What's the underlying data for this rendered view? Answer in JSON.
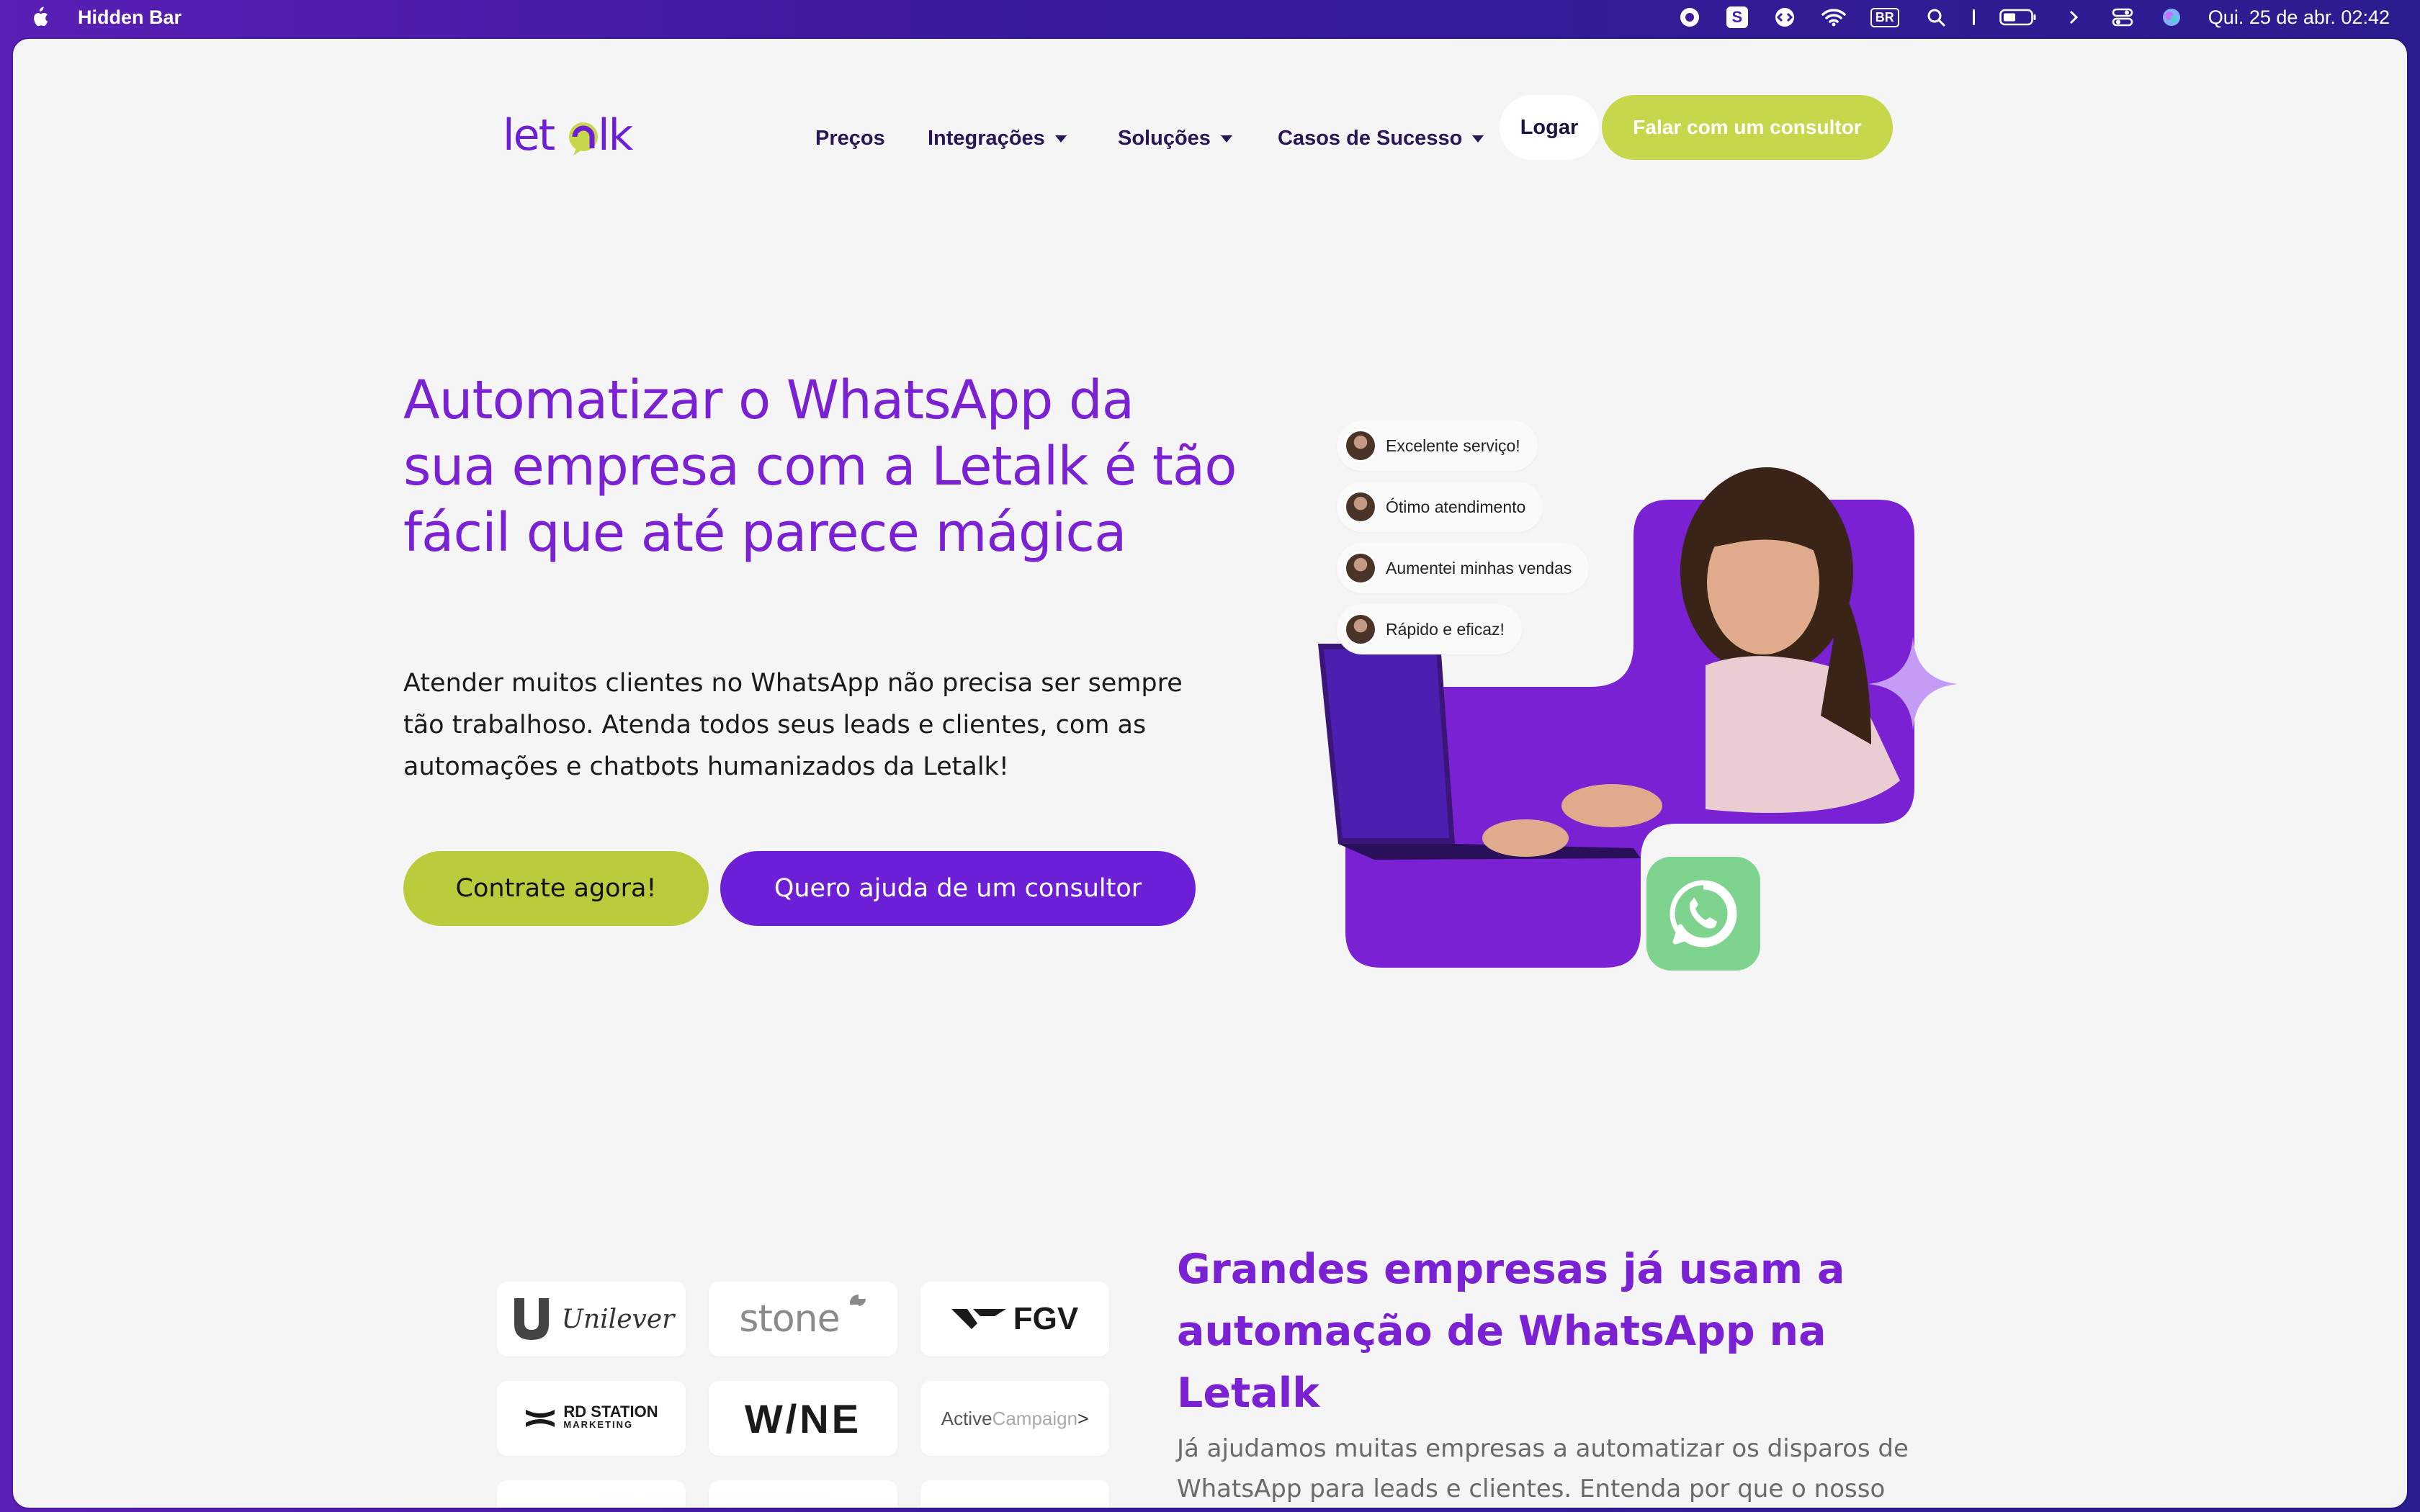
{
  "menubar": {
    "app_name": "Hidden Bar",
    "input_source": "BR",
    "skype_letter": "S",
    "clock": "Qui. 25 de abr.  02:42"
  },
  "nav": {
    "logo": "letalk",
    "items": [
      {
        "label": "Preços",
        "has_dropdown": false
      },
      {
        "label": "Integrações",
        "has_dropdown": true
      },
      {
        "label": "Soluções",
        "has_dropdown": true
      },
      {
        "label": "Casos de Sucesso",
        "has_dropdown": true
      }
    ],
    "login_label": "Logar",
    "consult_label": "Falar com um consultor"
  },
  "hero": {
    "title": "Automatizar o WhatsApp da sua empresa com a Letalk é tão fácil que até parece mágica",
    "subtitle": "Atender muitos clientes no WhatsApp não precisa ser sempre tão trabalhoso. Atenda todos seus leads e clientes, com as automações e chatbots humanizados da Letalk!",
    "cta_primary": "Contrate agora!",
    "cta_secondary": "Quero ajuda de um consultor",
    "testimonials": [
      "Excelente serviço!",
      "Ótimo atendimento",
      "Aumentei minhas vendas",
      "Rápido e eficaz!"
    ]
  },
  "clients": {
    "title": "Grandes empresas já usam a automação de WhatsApp na Letalk",
    "text": "Já ajudamos muitas empresas a automatizar os disparos de WhatsApp para leads e clientes. Entenda por que o nosso serviço também é ideal para o seu negócio. Conheça nossos",
    "logos": {
      "unilever": "Unilever",
      "stone": "stone",
      "fgv": "FGV",
      "rd_line1": "RD STATION",
      "rd_line2": "MARKETING",
      "wine": "W/NE",
      "ac_a": "Active",
      "ac_b": "Campaign",
      "ac_c": ">"
    }
  },
  "colors": {
    "brand_purple": "#7a22d3",
    "button_purple": "#6c1fd6",
    "lime": "#c7d64a",
    "whatsapp_green": "#7ed38f",
    "background": "#f5f5f6"
  }
}
